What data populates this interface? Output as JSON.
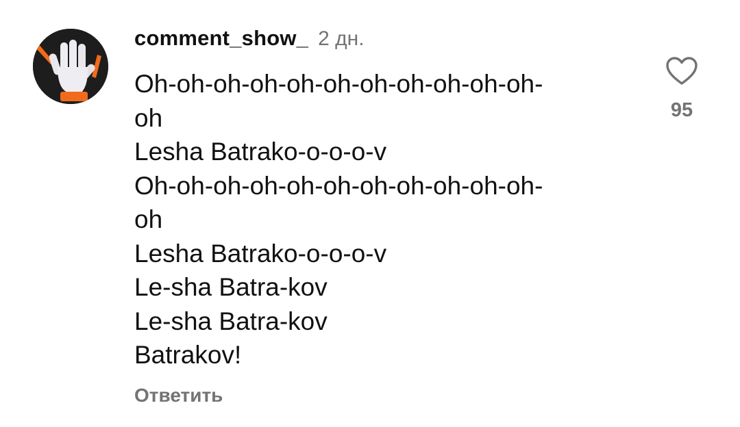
{
  "comment": {
    "username": "comment_show_",
    "timestamp": "2 дн.",
    "avatar_icon": "raised-hand-icon",
    "lines": [
      "Oh-oh-oh-oh-oh-oh-oh-oh-oh-oh-oh-",
      "oh",
      "Lesha Batrako-o-o-o-v",
      "Oh-oh-oh-oh-oh-oh-oh-oh-oh-oh-oh-",
      "oh",
      "Lesha Batrako-o-o-o-v",
      "Le-sha Batra-kov",
      "Le-sha Batra-kov",
      "Batrakov!"
    ],
    "reply_label": "Ответить",
    "like_icon": "heart-outline-icon",
    "like_count": "95",
    "colors": {
      "text": "#111111",
      "muted": "#737373",
      "avatar_bg": "#1d1d1d",
      "accent_orange": "#f26a1b"
    }
  }
}
